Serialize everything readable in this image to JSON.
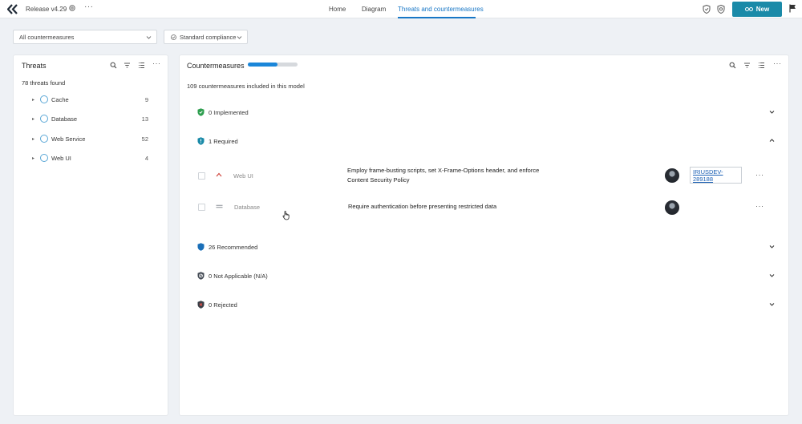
{
  "topbar": {
    "release": "Release v4.29",
    "nav": [
      "Home",
      "Diagram",
      "Threats and countermeasures"
    ],
    "new_label": "New",
    "icons": [
      "logo-icon",
      "gear-icon",
      "more-icon",
      "shield-icon",
      "shield-icon",
      "flag-icon"
    ]
  },
  "filters": {
    "countermeasures": "All countermeasures",
    "compliance": "Standard compliance"
  },
  "threats_panel": {
    "title": "Threats",
    "found": "78 threats found",
    "items": [
      {
        "label": "Cache",
        "count": "9"
      },
      {
        "label": "Database",
        "count": "13"
      },
      {
        "label": "Web Service",
        "count": "52"
      },
      {
        "label": "Web UI",
        "count": "4"
      }
    ]
  },
  "cm_panel": {
    "title": "Countermeasures",
    "progress": 0.6,
    "summary": "109 countermeasures included in this model",
    "groups": [
      {
        "label": "0 Implemented",
        "color": "#2e9e4f"
      },
      {
        "label": "1 Required",
        "color": "#1a8aa8"
      },
      {
        "label": "26 Recommended",
        "color": "#1a6fb8"
      },
      {
        "label": "0 Not Applicable (N/A)",
        "color": "#444b55"
      },
      {
        "label": "0 Rejected",
        "color": "#b03a3a"
      }
    ],
    "rows": [
      {
        "component": "Web UI",
        "text_line1": "Employ frame-busting scripts, set X-Frame-Options header, and enforce",
        "text_line2": "Content Security Policy",
        "issue_line1": "IRIUSDEV-",
        "issue_line2": "289188"
      },
      {
        "component": "Database",
        "text_line1": "Require authentication before presenting restricted data"
      }
    ]
  },
  "colors": {
    "accent": "#1877c6",
    "new_button": "#1a8aa8"
  }
}
